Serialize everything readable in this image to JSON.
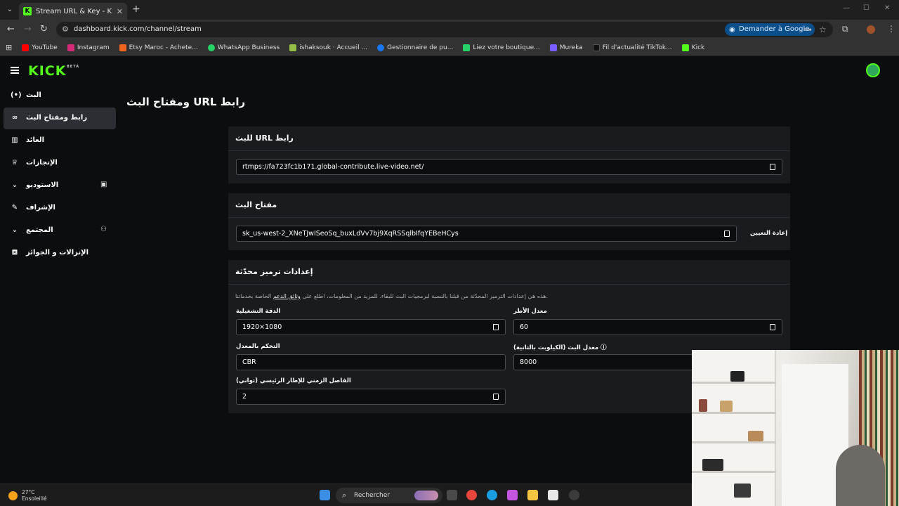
{
  "browser": {
    "tab_title": "Stream URL & Key - Kick Dashb",
    "url": "dashboard.kick.com/channel/stream",
    "google_button": "Demander à Google",
    "bookmarks": [
      {
        "label": "YouTube",
        "color": "#ff0000"
      },
      {
        "label": "Instagram",
        "color": "#d62976"
      },
      {
        "label": "Etsy Maroc - Achete...",
        "color": "#f1641e"
      },
      {
        "label": "WhatsApp Business",
        "color": "#25d366"
      },
      {
        "label": "ishaksouk · Accueil ...",
        "color": "#95bf47"
      },
      {
        "label": "Gestionnaire de pu...",
        "color": "#1877f2"
      },
      {
        "label": "Liez votre boutique...",
        "color": "#25d366"
      },
      {
        "label": "Mureka",
        "color": "#7b5cff"
      },
      {
        "label": "Fil d'actualité TikTok...",
        "color": "#111111"
      },
      {
        "label": "Kick",
        "color": "#53fc18"
      }
    ]
  },
  "header": {
    "logo": "KICK",
    "logo_badge": "BETA"
  },
  "sidebar": {
    "items": [
      {
        "label": "البث",
        "icon": "broadcast-icon",
        "glyph": "(•)"
      },
      {
        "label": "رابط ومفتاح البث",
        "icon": "link-icon",
        "glyph": "∞"
      },
      {
        "label": "العائد",
        "icon": "bar-chart-icon",
        "glyph": "▥"
      },
      {
        "label": "الإنجازات",
        "icon": "trophy-icon",
        "glyph": "♕"
      },
      {
        "label": "الاستوديو",
        "icon": "chevron-down-icon",
        "glyph": "⌄",
        "right": "▣"
      },
      {
        "label": "الإشراف",
        "icon": "wrench-icon",
        "glyph": "✎"
      },
      {
        "label": "المجتمع",
        "icon": "chevron-down-icon",
        "glyph": "⌄",
        "right": "⚇"
      },
      {
        "label": "الإنزالات و الجوائز",
        "icon": "gift-icon",
        "glyph": "⛾"
      }
    ]
  },
  "page": {
    "title": "ومفتاح البث URL رابط"
  },
  "stream_url": {
    "heading": "للبث URL رابط",
    "value": "rtmps://fa723fc1b171.global-contribute.live-video.net/"
  },
  "stream_key": {
    "heading": "مفتاح البث",
    "value": "sk_us-west-2_XNeTJwISeoSq_buxLdVv7bj9XqRSSqlbIfqYEBeHCys",
    "reset_label": "إعادة التعيين"
  },
  "encoder": {
    "heading": "إعدادات ترميز محدّثة",
    "description_before": "هذه هي إعدادات الترميز المحدّثة من قبلنا بالنسبة لبرمجيات البث للبقاء. للمزيد من المعلومات، اطلع على",
    "description_link": "وثائق الدعم",
    "description_after": "الخاصة بخدماتنا.",
    "resolution_label": "الدقة التشغيلية",
    "resolution_value": "1920×1080",
    "framerate_label": "معدل الأطر",
    "framerate_value": "60",
    "rate_control_label": "التحكم بالمعدل",
    "rate_control_value": "CBR",
    "bitrate_label": "معدل البث (الكيلوبت بالثانية)",
    "bitrate_value": "8000",
    "keyframe_label": "الفاصل الزمني للإطار الرئيسي (ثواني)",
    "keyframe_value": "2"
  },
  "taskbar": {
    "temperature": "27°C",
    "weather": "Ensoleillé",
    "search_placeholder": "Rechercher"
  }
}
